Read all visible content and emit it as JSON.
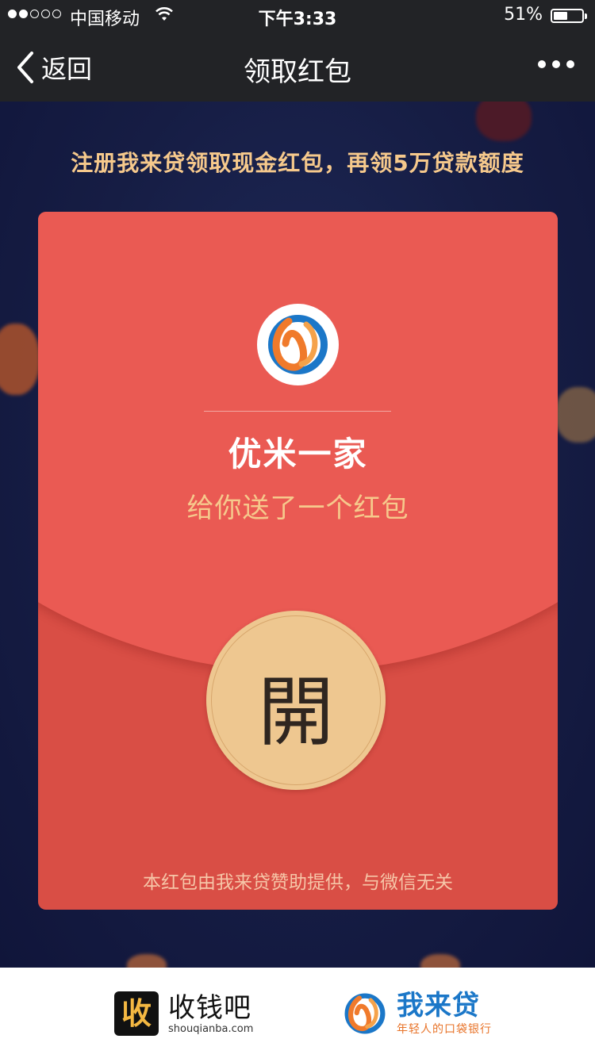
{
  "status_bar": {
    "carrier": "中国移动",
    "time": "下午3:33",
    "battery": "51%",
    "battery_level": 0.51,
    "signal_bars_filled": 2,
    "signal_bars_total": 5
  },
  "nav": {
    "back_label": "返回",
    "title": "领取红包",
    "more_icon": "more-dots-icon"
  },
  "promo": "注册我来贷领取现金红包，再领5万贷款额度",
  "envelope": {
    "sender": "优米一家",
    "subtitle": "给你送了一个红包",
    "open_label": "開",
    "disclaimer": "本红包由我来贷赞助提供，与微信无关"
  },
  "footer": {
    "brand_a": {
      "badge": "收",
      "name": "收钱吧",
      "domain": "shouqianba.com"
    },
    "brand_b": {
      "name": "我来贷",
      "slogan": "年轻人的口袋银行"
    }
  },
  "colors": {
    "envelope": "#d94e45",
    "flap": "#ea5a53",
    "gold": "#eec790",
    "accent_text": "#f6c98c",
    "navbar": "#222326",
    "brand_blue": "#1b77c8",
    "brand_orange": "#e8742a"
  }
}
